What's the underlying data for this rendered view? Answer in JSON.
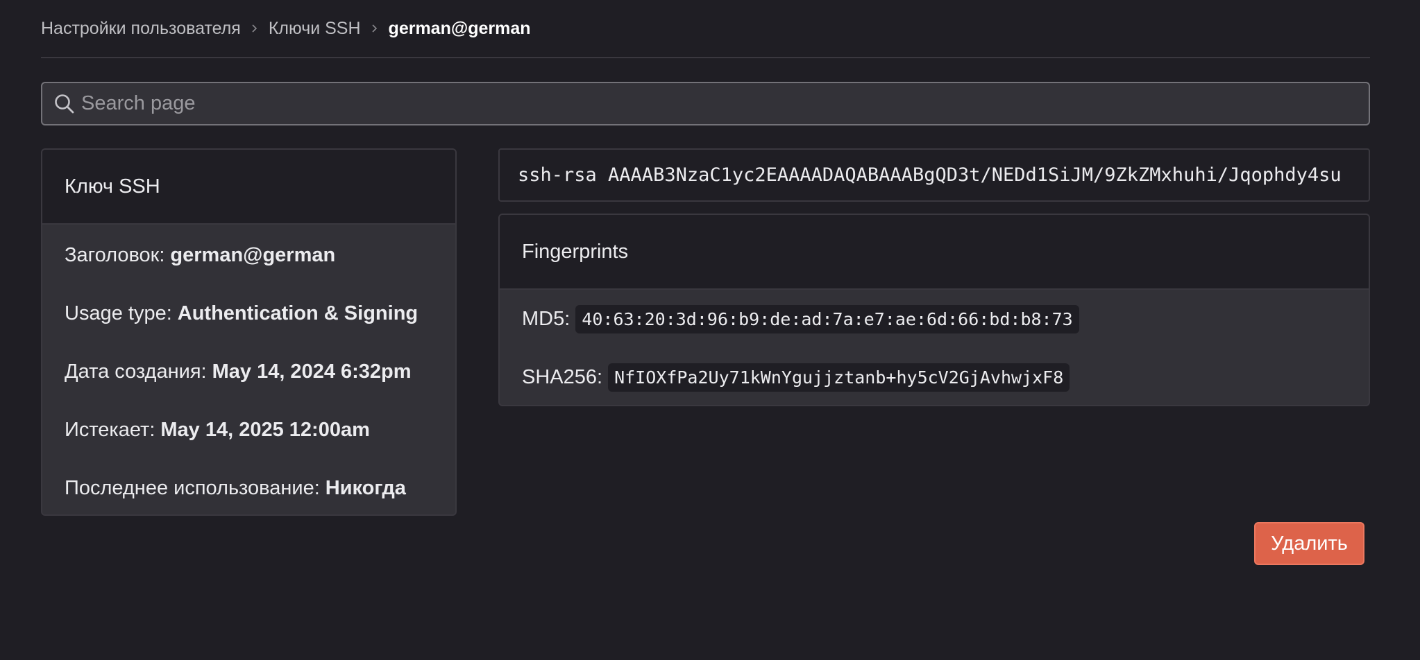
{
  "breadcrumb": {
    "items": [
      "Настройки пользователя",
      "Ключи SSH"
    ],
    "current": "german@german"
  },
  "search": {
    "placeholder": "Search page",
    "value": ""
  },
  "ssh_key_card": {
    "title": "Ключ SSH",
    "details": [
      {
        "label": "Заголовок:",
        "value": "german@german"
      },
      {
        "label": "Usage type:",
        "value": "Authentication & Signing"
      },
      {
        "label": "Дата создания:",
        "value": "May 14, 2024 6:32pm"
      },
      {
        "label": "Истекает:",
        "value": "May 14, 2025 12:00am"
      },
      {
        "label": "Последнее использование:",
        "value": "Никогда"
      }
    ]
  },
  "key_text": "ssh-rsa AAAAB3NzaC1yc2EAAAADAQABAAABgQD3t/NEDd1SiJM/9ZkZMxhuhi/Jqophdy4su",
  "fingerprints": {
    "title": "Fingerprints",
    "md5": {
      "label": "MD5:",
      "value": "40:63:20:3d:96:b9:de:ad:7a:e7:ae:6d:66:bd:b8:73"
    },
    "sha256": {
      "label": "SHA256:",
      "value": "NfIOXfPa2Uy71kWnYgujjztanb+hy5cV2GjAvhwjxF8"
    }
  },
  "actions": {
    "delete_label": "Удалить"
  },
  "colors": {
    "background": "#1f1e24",
    "card": "#323137",
    "danger": "#dd634a"
  },
  "icons": {
    "search": "search-icon",
    "separator": "chevron-right-icon"
  }
}
